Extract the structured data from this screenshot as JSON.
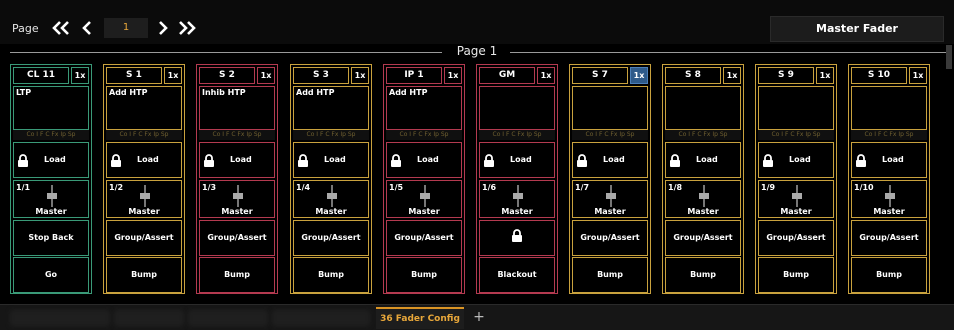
{
  "toolbar": {
    "page_label": "Page",
    "page_value": "1",
    "master_fader_label": "Master Fader"
  },
  "page_title": "Page 1",
  "colors": {
    "gold": "#c9a23e",
    "green": "#3a9a78",
    "red": "#b43a50",
    "accent": "#e8a73a",
    "active_rate": "#2e5a8a"
  },
  "attributes_label": "Co I F C Fx Ip Sp",
  "load_label": "Load",
  "master_label": "Master",
  "faders": [
    {
      "name": "CL 11",
      "rate": "1x",
      "cue_text": "LTP",
      "slot": "1/1",
      "button1": "Stop Back",
      "button2": "Go",
      "color": "green",
      "rate_active": false,
      "button1_lock": false
    },
    {
      "name": "S 1",
      "rate": "1x",
      "cue_text": "Add HTP",
      "slot": "1/2",
      "button1": "Group/Assert",
      "button2": "Bump",
      "color": "gold",
      "rate_active": false,
      "button1_lock": false
    },
    {
      "name": "S 2",
      "rate": "1x",
      "cue_text": "Inhib HTP",
      "slot": "1/3",
      "button1": "Group/Assert",
      "button2": "Bump",
      "color": "red",
      "rate_active": false,
      "button1_lock": false
    },
    {
      "name": "S 3",
      "rate": "1x",
      "cue_text": "Add HTP",
      "slot": "1/4",
      "button1": "Group/Assert",
      "button2": "Bump",
      "color": "gold",
      "rate_active": false,
      "button1_lock": false
    },
    {
      "name": "IP 1",
      "rate": "1x",
      "cue_text": "Add HTP",
      "slot": "1/5",
      "button1": "Group/Assert",
      "button2": "Bump",
      "color": "red",
      "rate_active": false,
      "button1_lock": false
    },
    {
      "name": "GM",
      "rate": "1x",
      "cue_text": "",
      "slot": "1/6",
      "button1": "",
      "button2": "Blackout",
      "color": "red",
      "rate_active": false,
      "button1_lock": true
    },
    {
      "name": "S 7",
      "rate": "1x",
      "cue_text": "",
      "slot": "1/7",
      "button1": "Group/Assert",
      "button2": "Bump",
      "color": "gold",
      "rate_active": true,
      "button1_lock": false
    },
    {
      "name": "S 8",
      "rate": "1x",
      "cue_text": "",
      "slot": "1/8",
      "button1": "Group/Assert",
      "button2": "Bump",
      "color": "gold",
      "rate_active": false,
      "button1_lock": false
    },
    {
      "name": "S 9",
      "rate": "1x",
      "cue_text": "",
      "slot": "1/9",
      "button1": "Group/Assert",
      "button2": "Bump",
      "color": "gold",
      "rate_active": false,
      "button1_lock": false
    },
    {
      "name": "S 10",
      "rate": "1x",
      "cue_text": "",
      "slot": "1/10",
      "button1": "Group/Assert",
      "button2": "Bump",
      "color": "gold",
      "rate_active": false,
      "button1_lock": false
    }
  ],
  "tabs": {
    "active_label": "36 Fader Config",
    "add_label": "+"
  }
}
